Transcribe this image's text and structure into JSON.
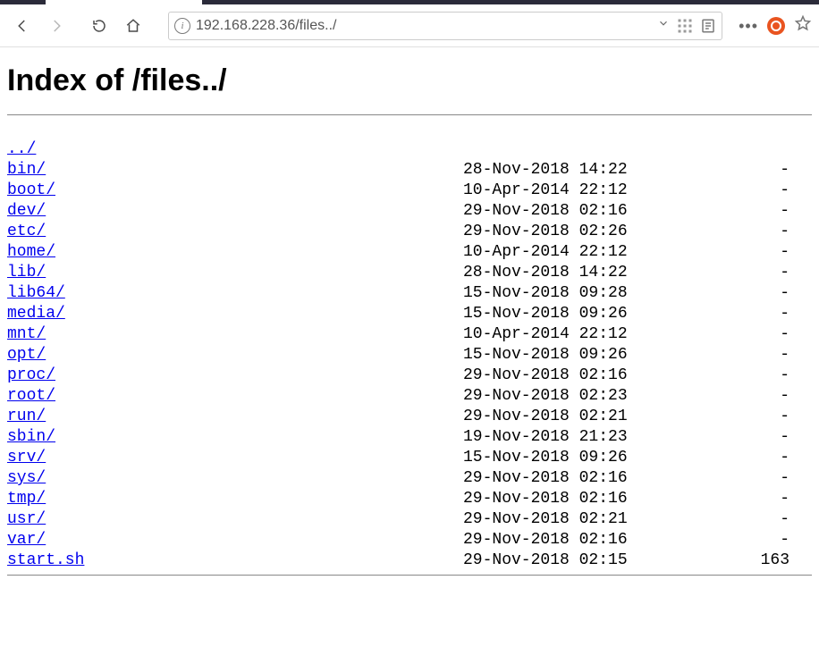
{
  "toolbar": {
    "url": "192.168.228.36/files../"
  },
  "page": {
    "heading": "Index of /files../",
    "parent_link": "../",
    "entries": [
      {
        "name": "bin/",
        "date": "28-Nov-2018 14:22",
        "size": "-"
      },
      {
        "name": "boot/",
        "date": "10-Apr-2014 22:12",
        "size": "-"
      },
      {
        "name": "dev/",
        "date": "29-Nov-2018 02:16",
        "size": "-"
      },
      {
        "name": "etc/",
        "date": "29-Nov-2018 02:26",
        "size": "-"
      },
      {
        "name": "home/",
        "date": "10-Apr-2014 22:12",
        "size": "-"
      },
      {
        "name": "lib/",
        "date": "28-Nov-2018 14:22",
        "size": "-"
      },
      {
        "name": "lib64/",
        "date": "15-Nov-2018 09:28",
        "size": "-"
      },
      {
        "name": "media/",
        "date": "15-Nov-2018 09:26",
        "size": "-"
      },
      {
        "name": "mnt/",
        "date": "10-Apr-2014 22:12",
        "size": "-"
      },
      {
        "name": "opt/",
        "date": "15-Nov-2018 09:26",
        "size": "-"
      },
      {
        "name": "proc/",
        "date": "29-Nov-2018 02:16",
        "size": "-"
      },
      {
        "name": "root/",
        "date": "29-Nov-2018 02:23",
        "size": "-"
      },
      {
        "name": "run/",
        "date": "29-Nov-2018 02:21",
        "size": "-"
      },
      {
        "name": "sbin/",
        "date": "19-Nov-2018 21:23",
        "size": "-"
      },
      {
        "name": "srv/",
        "date": "15-Nov-2018 09:26",
        "size": "-"
      },
      {
        "name": "sys/",
        "date": "29-Nov-2018 02:16",
        "size": "-"
      },
      {
        "name": "tmp/",
        "date": "29-Nov-2018 02:16",
        "size": "-"
      },
      {
        "name": "usr/",
        "date": "29-Nov-2018 02:21",
        "size": "-"
      },
      {
        "name": "var/",
        "date": "29-Nov-2018 02:16",
        "size": "-"
      },
      {
        "name": "start.sh",
        "date": "29-Nov-2018 02:15",
        "size": "163"
      }
    ]
  }
}
